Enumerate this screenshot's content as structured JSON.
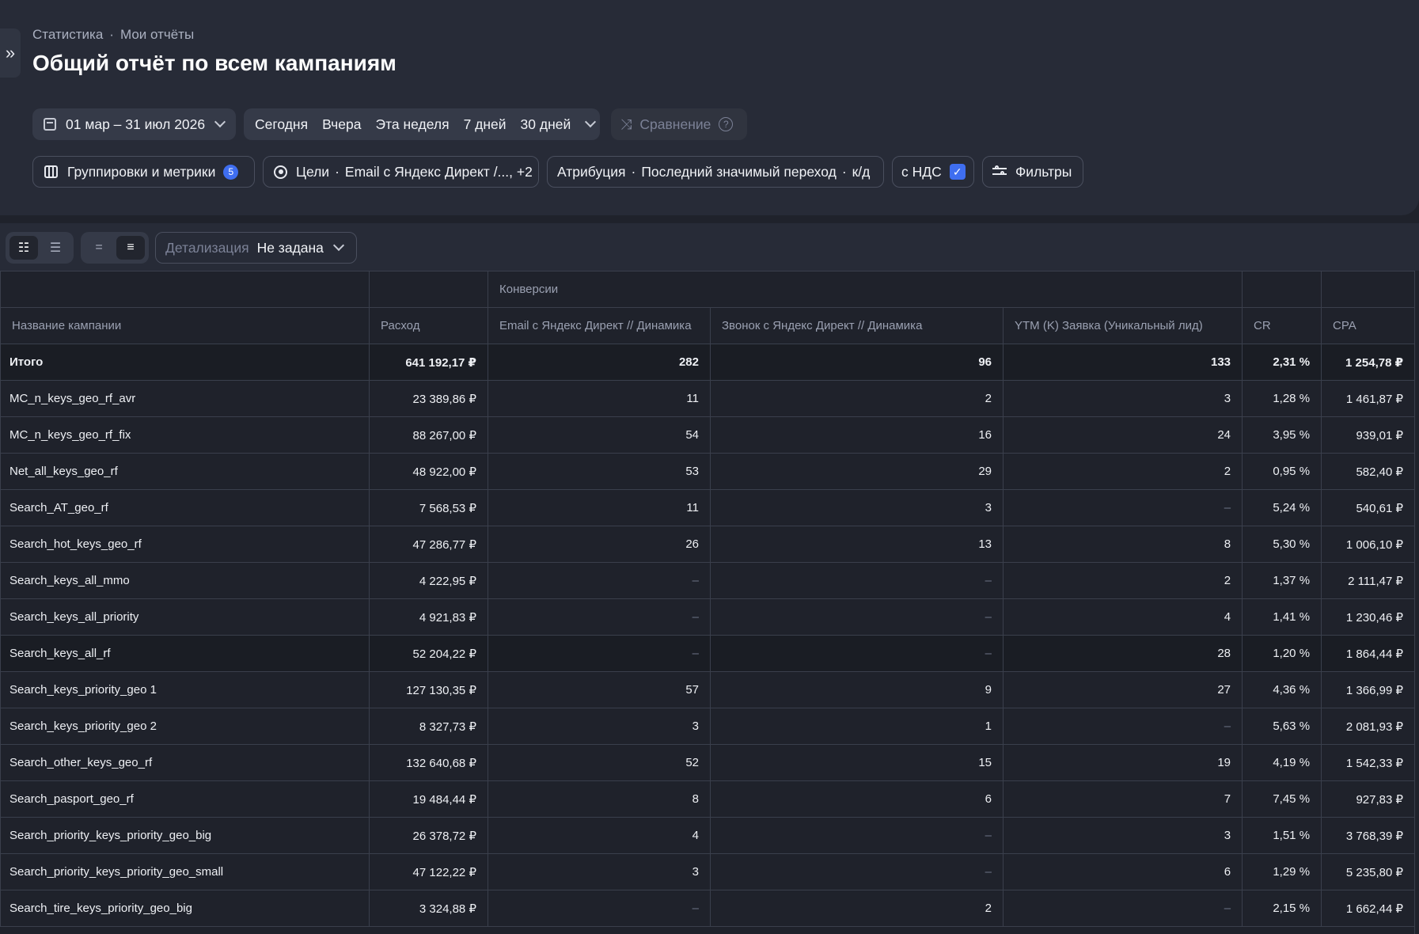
{
  "breadcrumb": [
    "Статистика",
    "Мои отчёты"
  ],
  "title": "Общий отчёт по всем кампаниям",
  "date_range": "01 мар – 31 июл 2026",
  "periods": [
    "Сегодня",
    "Вчера",
    "Эта неделя",
    "7 дней",
    "30 дней"
  ],
  "compare_label": "Сравнение",
  "groupings": {
    "label": "Группировки и метрики",
    "count": "5"
  },
  "goals": {
    "label": "Цели",
    "value": "Email с Яндекс Директ /..., +2"
  },
  "attribution": {
    "label": "Атрибуция",
    "value": "Последний значимый переход",
    "suffix": "к/д"
  },
  "vat_label": "с НДС",
  "filters_label": "Фильтры",
  "detail": {
    "label": "Детализация",
    "value": "Не задана"
  },
  "table": {
    "group_header": "Конверсии",
    "columns": [
      "Название кампании",
      "Расход",
      "Email с Яндекс Директ // Динамика",
      "Звонок с Яндекс Директ // Динамика",
      "YTM (K) Заявка (Уникальный лид)",
      "CR",
      "CPA"
    ],
    "total": [
      "Итого",
      "641 192,17 ₽",
      "282",
      "96",
      "133",
      "2,31 %",
      "1 254,78 ₽"
    ],
    "rows": [
      [
        "MC_n_keys_geo_rf_avr",
        "23 389,86 ₽",
        "11",
        "2",
        "3",
        "1,28 %",
        "1 461,87 ₽"
      ],
      [
        "MC_n_keys_geo_rf_fix",
        "88 267,00 ₽",
        "54",
        "16",
        "24",
        "3,95 %",
        "939,01 ₽"
      ],
      [
        "Net_all_keys_geo_rf",
        "48 922,00 ₽",
        "53",
        "29",
        "2",
        "0,95 %",
        "582,40 ₽"
      ],
      [
        "Search_AT_geo_rf",
        "7 568,53 ₽",
        "11",
        "3",
        "–",
        "5,24 %",
        "540,61 ₽"
      ],
      [
        "Search_hot_keys_geo_rf",
        "47 286,77 ₽",
        "26",
        "13",
        "8",
        "5,30 %",
        "1 006,10 ₽"
      ],
      [
        "Search_keys_all_mmo",
        "4 222,95 ₽",
        "–",
        "–",
        "2",
        "1,37 %",
        "2 111,47 ₽"
      ],
      [
        "Search_keys_all_priority",
        "4 921,83 ₽",
        "–",
        "–",
        "4",
        "1,41 %",
        "1 230,46 ₽"
      ],
      [
        "Search_keys_all_rf",
        "52 204,22 ₽",
        "–",
        "–",
        "28",
        "1,20 %",
        "1 864,44 ₽"
      ],
      [
        "Search_keys_priority_geo 1",
        "127 130,35 ₽",
        "57",
        "9",
        "27",
        "4,36 %",
        "1 366,99 ₽"
      ],
      [
        "Search_keys_priority_geo 2",
        "8 327,73 ₽",
        "3",
        "1",
        "–",
        "5,63 %",
        "2 081,93 ₽"
      ],
      [
        "Search_other_keys_geo_rf",
        "132 640,68 ₽",
        "52",
        "15",
        "19",
        "4,19 %",
        "1 542,33 ₽"
      ],
      [
        "Search_pasport_geo_rf",
        "19 484,44 ₽",
        "8",
        "6",
        "7",
        "7,45 %",
        "927,83 ₽"
      ],
      [
        "Search_priority_keys_priority_geo_big",
        "26 378,72 ₽",
        "4",
        "–",
        "3",
        "1,51 %",
        "3 768,39 ₽"
      ],
      [
        "Search_priority_keys_priority_geo_small",
        "47 122,22 ₽",
        "3",
        "–",
        "6",
        "1,29 %",
        "5 235,80 ₽"
      ],
      [
        "Search_tire_keys_priority_geo_big",
        "3 324,88 ₽",
        "–",
        "2",
        "–",
        "2,15 %",
        "1 662,44 ₽"
      ]
    ]
  },
  "colors": {
    "accent": "#3f6ef0",
    "panel": "#272b37",
    "background": "#1f222b"
  }
}
